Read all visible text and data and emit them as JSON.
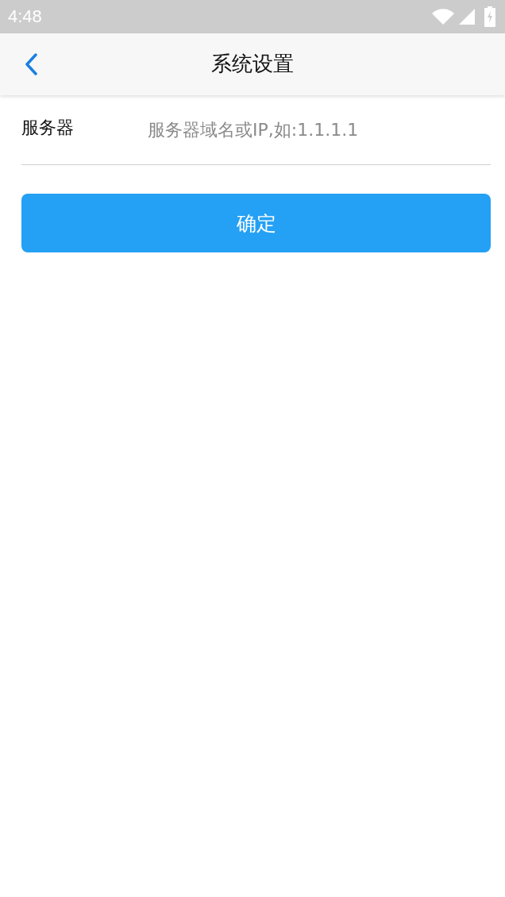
{
  "status_bar": {
    "time": "4:48"
  },
  "header": {
    "title": "系统设置"
  },
  "form": {
    "fields": [
      {
        "label": "服务器",
        "placeholder": "服务器域名或IP,如:1.1.1.1"
      }
    ]
  },
  "buttons": [
    {
      "label": "确定"
    }
  ]
}
